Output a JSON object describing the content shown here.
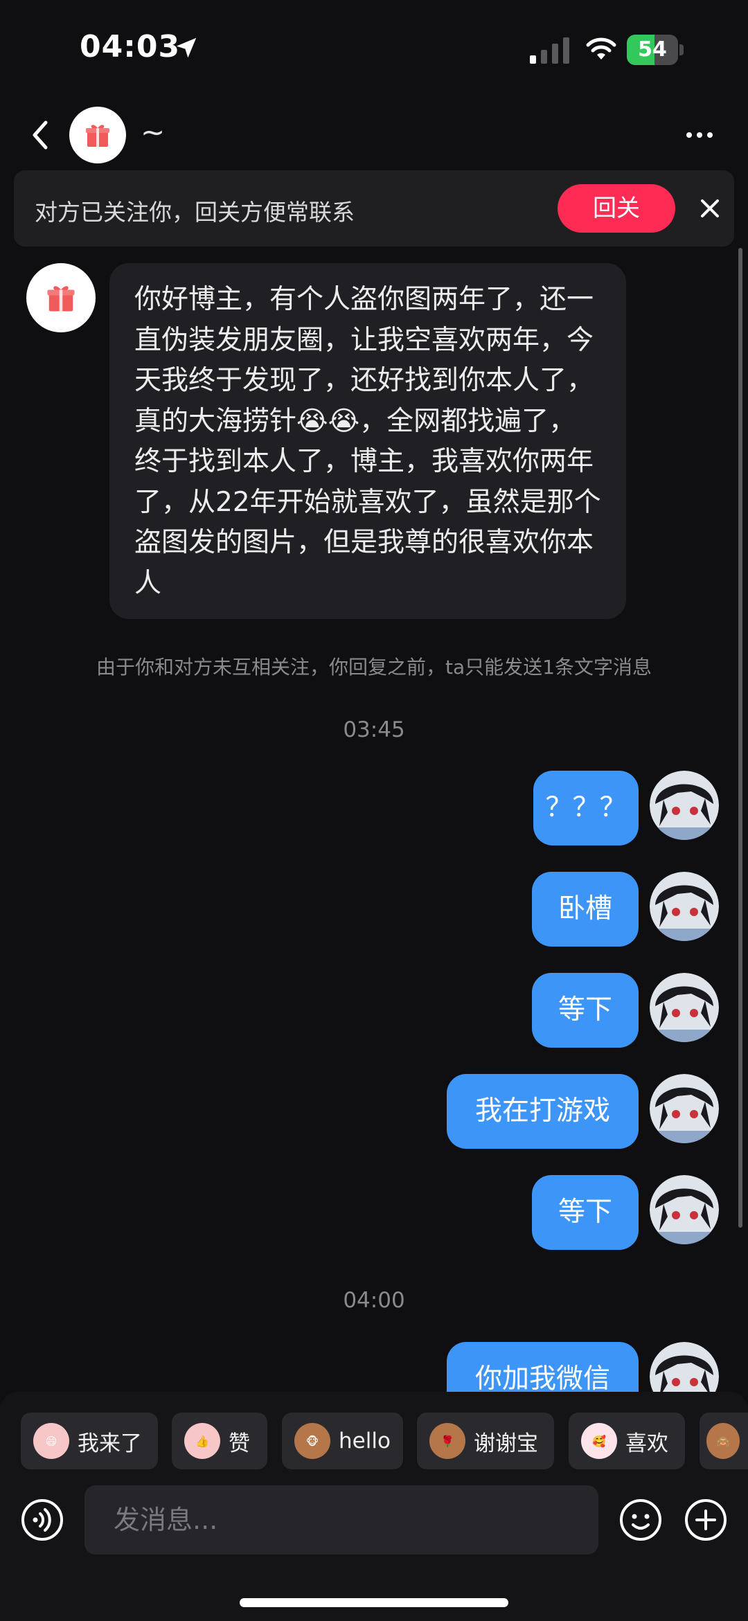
{
  "status_bar": {
    "time": "04:03",
    "battery": "54"
  },
  "header": {
    "contact_name": "~"
  },
  "follow_banner": {
    "text": "对方已关注你，回关方便常联系",
    "button_label": "回关"
  },
  "incoming_message": {
    "text": "你好博主，有个人盗你图两年了，还一直伪装发朋友圈，让我空喜欢两年，今天我终于发现了，还好找到你本人了，真的大海捞针😭😭，全网都找遍了，终于找到本人了，博主，我喜欢你两年了，从22年开始就喜欢了，虽然是那个盗图发的图片，但是我尊的很喜欢你本人"
  },
  "notice": "由于你和对方未互相关注，你回复之前，ta只能发送1条文字消息",
  "timestamps": [
    "03:45",
    "04:00"
  ],
  "outgoing_messages": [
    {
      "text": "？？？"
    },
    {
      "text": "卧槽"
    },
    {
      "text": "等下"
    },
    {
      "text": "我在打游戏"
    },
    {
      "text": "等下"
    },
    {
      "text": "你加我微信"
    }
  ],
  "quick_replies": [
    {
      "label": "我来了",
      "emoji": "😄"
    },
    {
      "label": "赞",
      "emoji": "👍"
    },
    {
      "label": "hello",
      "emoji": "🐵"
    },
    {
      "label": "谢谢宝",
      "emoji": "🌹"
    },
    {
      "label": "喜欢",
      "emoji": "🥰"
    },
    {
      "label": "",
      "emoji": "🙈"
    }
  ],
  "input": {
    "placeholder": "发消息..."
  },
  "colors": {
    "background": "#0f0f11",
    "outgoing_bubble": "#3d96f7",
    "incoming_bubble": "#202024",
    "follow_button": "#fe2c55",
    "battery": "#34c759"
  },
  "icons": {
    "back": "chevron-left-icon",
    "more": "ellipsis-icon",
    "close": "close-icon",
    "voice": "voice-icon",
    "emoji": "smiley-icon",
    "plus": "plus-icon",
    "gift": "gift-icon"
  }
}
